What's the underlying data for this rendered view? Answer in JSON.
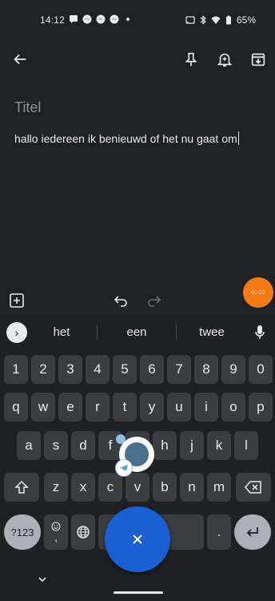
{
  "status_bar": {
    "time": "14:12",
    "battery": "65%"
  },
  "note": {
    "title_placeholder": "Titel",
    "body": "hallo iedereen ik benieuwd of het nu gaat om"
  },
  "overlay": {
    "orange_bubble_text": "00:00"
  },
  "keyboard": {
    "suggestions": [
      "het",
      "een",
      "twee"
    ],
    "row_numbers": [
      "1",
      "2",
      "3",
      "4",
      "5",
      "6",
      "7",
      "8",
      "9",
      "0"
    ],
    "row1": [
      "q",
      "w",
      "e",
      "r",
      "t",
      "y",
      "u",
      "i",
      "o",
      "p"
    ],
    "row2": [
      "a",
      "s",
      "d",
      "f",
      "g",
      "h",
      "j",
      "k",
      "l"
    ],
    "row3": [
      "z",
      "x",
      "c",
      "v",
      "b",
      "n",
      "m"
    ],
    "symbols_label": "?123",
    "comma_label": ",",
    "period_label": "."
  },
  "colors": {
    "background": "#202124",
    "key": "#3c3d40",
    "fab": "#1a5fd3",
    "orange": "#f47a18"
  }
}
